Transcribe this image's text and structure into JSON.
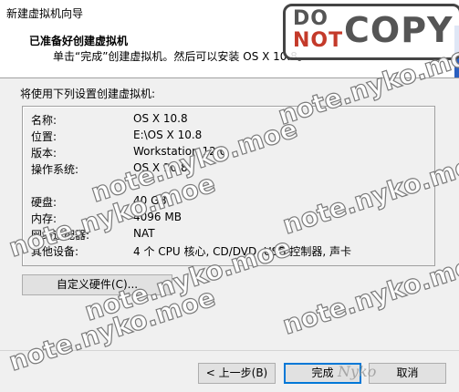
{
  "window": {
    "title": "新建虚拟机向导"
  },
  "header": {
    "heading": "已准备好创建虚拟机",
    "subheading": "单击“完成”创建虚拟机。然后可以安装 OS X 10.8。"
  },
  "summary": {
    "intro": "将使用下列设置创建虚拟机:",
    "rows": [
      {
        "label": "名称:",
        "value": "OS X 10.8"
      },
      {
        "label": "位置:",
        "value": "E:\\OS X 10.8"
      },
      {
        "label": "版本:",
        "value": "Workstation 12.0"
      },
      {
        "label": "操作系统:",
        "value": "OS X 10.8"
      },
      {
        "label": "硬盘:",
        "value": "40 GB"
      },
      {
        "label": "内存:",
        "value": "4096 MB"
      },
      {
        "label": "网络适配器:",
        "value": "NAT"
      },
      {
        "label": "其他设备:",
        "value": "4 个 CPU 核心, CD/DVD, USB 控制器, 声卡"
      }
    ]
  },
  "buttons": {
    "customize": "自定义硬件(C)...",
    "back": "< 上一步(B)",
    "finish": "完成",
    "cancel": "取消"
  },
  "overlay": {
    "stamp_do": "DO",
    "stamp_not": "NOT",
    "stamp_copy": "COPY",
    "watermark": "note.nyko.moe",
    "signature": "Nyko"
  }
}
